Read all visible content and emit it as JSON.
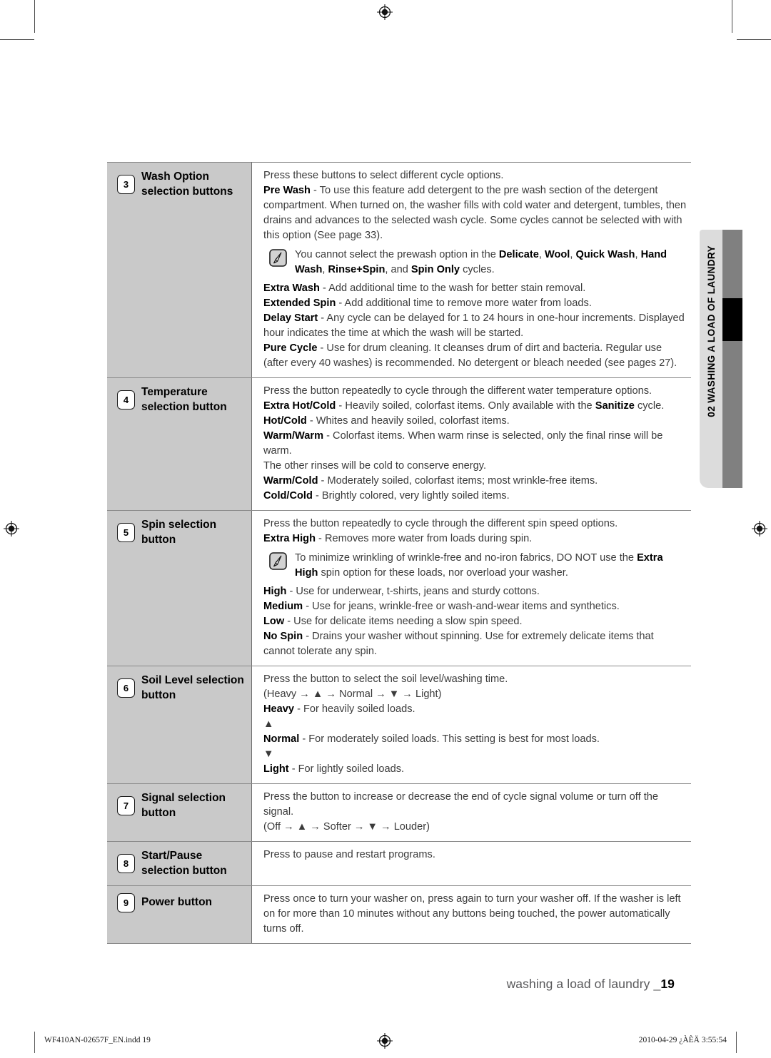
{
  "side_tab": {
    "label": "02 WASHING A LOAD OF LAUNDRY"
  },
  "footer": {
    "caption": "washing a load of laundry _",
    "page_number": "19",
    "file_name": "WF410AN-02657F_EN.indd   19",
    "timestamp": "2010-04-29   ¿ÀÈÄ 3:55:54"
  },
  "rows": [
    {
      "number": "3",
      "label": "Wash Option selection buttons",
      "lines": [
        "Press these buttons to select different cycle options.",
        "Pre Wash - To use this feature add detergent to the pre wash section of the detergent compartment. When turned on, the washer fills with cold water and detergent, tumbles, then drains and advances to the selected wash cycle. Some cycles cannot be selected with with this option (See page 33)."
      ],
      "note": "You cannot select the prewash option in the Delicate, Wool, Quick Wash, Hand Wash, Rinse+Spin, and Spin Only cycles.",
      "lines_after": [
        "Extra Wash - Add additional time to the wash for better stain removal.",
        "Extended Spin - Add additional time to remove more water from loads.",
        "Delay Start - Any cycle can be delayed for 1 to 24 hours in one-hour increments. Displayed hour indicates the time at which the wash will be started.",
        "Pure Cycle - Use for drum cleaning. It cleanses drum of dirt and bacteria. Regular use (after every 40 washes) is recommended. No detergent or bleach needed (see pages 27)."
      ]
    },
    {
      "number": "4",
      "label": "Temperature selection button",
      "lines": [
        "Press the button repeatedly to cycle through the different water temperature options.",
        "Extra Hot/Cold - Heavily soiled, colorfast items. Only available with the Sanitize cycle.",
        "Hot/Cold - Whites and heavily soiled, colorfast items.",
        "Warm/Warm - Colorfast items. When warm rinse is selected, only the final rinse will be warm.",
        "The other rinses will be cold to conserve energy.",
        "Warm/Cold - Moderately soiled, colorfast items; most wrinkle-free items.",
        "Cold/Cold - Brightly colored, very lightly soiled items."
      ]
    },
    {
      "number": "5",
      "label": "Spin selection button",
      "lines": [
        "Press the button repeatedly to cycle through the different spin speed options.",
        "Extra High - Removes more water from loads during spin."
      ],
      "note": "To minimize wrinkling of wrinkle-free and no-iron fabrics, DO NOT use the Extra High spin option for these loads, nor overload your washer.",
      "lines_after": [
        "High - Use for underwear, t-shirts, jeans and sturdy cottons.",
        "Medium - Use for jeans, wrinkle-free or wash-and-wear items and synthetics.",
        "Low - Use for delicate items needing a slow spin speed.",
        "No Spin - Drains your washer without spinning. Use for extremely delicate items that cannot tolerate any spin."
      ]
    },
    {
      "number": "6",
      "label": "Soil Level selection button",
      "lines": [
        "Press the button to select the soil level/washing time.",
        "(Heavy → ▲ → Normal → ▼ → Light)",
        "Heavy - For heavily soiled loads.",
        "▲",
        "Normal - For moderately soiled loads. This setting is best for most loads.",
        "▼",
        "Light - For lightly soiled loads."
      ]
    },
    {
      "number": "7",
      "label": "Signal selection button",
      "lines": [
        "Press the button to increase or decrease the end of cycle signal volume or turn off the signal.",
        "(Off → ▲ → Softer → ▼ → Louder)"
      ]
    },
    {
      "number": "8",
      "label": "Start/Pause selection button",
      "lines": [
        "Press to pause and restart programs."
      ]
    },
    {
      "number": "9",
      "label": "Power button",
      "lines": [
        "Press once to turn your washer on, press again to turn your washer off. If the washer is left on for more than 10 minutes without any buttons being touched, the power automatically turns off."
      ]
    }
  ]
}
